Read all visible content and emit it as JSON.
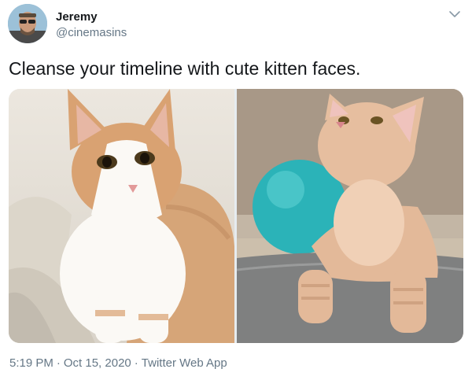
{
  "author": {
    "name": "Jeremy",
    "handle": "@cinemasins",
    "avatar_icon": "avatar-photo-icon",
    "menu_icon": "chevron-down-icon"
  },
  "tweet": {
    "text": "Cleanse your timeline with cute kitten faces.",
    "photos": [
      {
        "icon": "cat-photo-icon"
      },
      {
        "icon": "cat-photo-icon"
      }
    ]
  },
  "meta": {
    "time": "5:19 PM",
    "separator": "·",
    "date": "Oct 15, 2020",
    "source": "Twitter Web App"
  },
  "colors": {
    "text_primary": "#14171a",
    "text_secondary": "#657786",
    "icon_gray": "#657786"
  }
}
